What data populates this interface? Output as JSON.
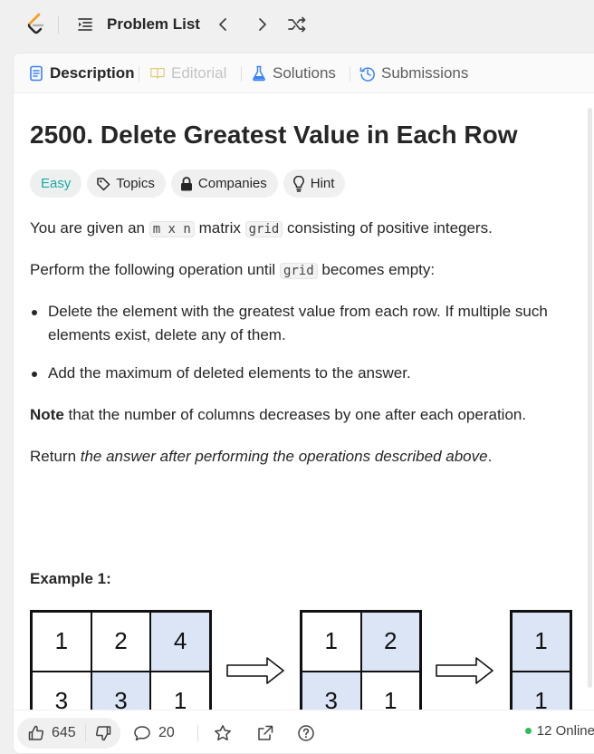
{
  "nav": {
    "problem_list_label": "Problem List"
  },
  "tabs": [
    {
      "label": "Description"
    },
    {
      "label": "Editorial"
    },
    {
      "label": "Solutions"
    },
    {
      "label": "Submissions"
    }
  ],
  "problem": {
    "title": "2500. Delete Greatest Value in Each Row",
    "difficulty": "Easy",
    "tags": [
      "Topics",
      "Companies",
      "Hint"
    ],
    "p1_a": "You are given an ",
    "p1_code1": "m x n",
    "p1_b": " matrix ",
    "p1_code2": "grid",
    "p1_c": " consisting of positive integers.",
    "p2_a": "Perform the following operation until ",
    "p2_code": "grid",
    "p2_b": " becomes empty:",
    "bullet1": "Delete the element with the greatest value from each row. If multiple such elements exist, delete any of them.",
    "bullet2": "Add the maximum of deleted elements to the answer.",
    "note_bold": "Note",
    "note_rest": " that the number of columns decreases by one after each operation.",
    "return_a": "Return ",
    "return_italic": "the answer after performing the operations described above",
    "return_b": ".",
    "example_heading": "Example 1:"
  },
  "example_grids": [
    {
      "rows": [
        [
          "1",
          "2",
          "4"
        ],
        [
          "3",
          "3",
          "1"
        ]
      ],
      "highlight": [
        [
          false,
          false,
          true
        ],
        [
          false,
          true,
          false
        ]
      ]
    },
    {
      "rows": [
        [
          "1",
          "2"
        ],
        [
          "3",
          "1"
        ]
      ],
      "highlight": [
        [
          false,
          true
        ],
        [
          true,
          false
        ]
      ]
    },
    {
      "rows": [
        [
          "1"
        ],
        [
          "1"
        ]
      ],
      "highlight": [
        [
          true
        ],
        [
          true
        ]
      ]
    }
  ],
  "bottom": {
    "likes": "645",
    "comments": "20",
    "online": "12 Online"
  },
  "colors": {
    "easy": "#1ba8a3",
    "highlight_cell": "#dbe5f6",
    "online_dot": "#2cbb5d",
    "logo_orange": "#ffa116"
  }
}
